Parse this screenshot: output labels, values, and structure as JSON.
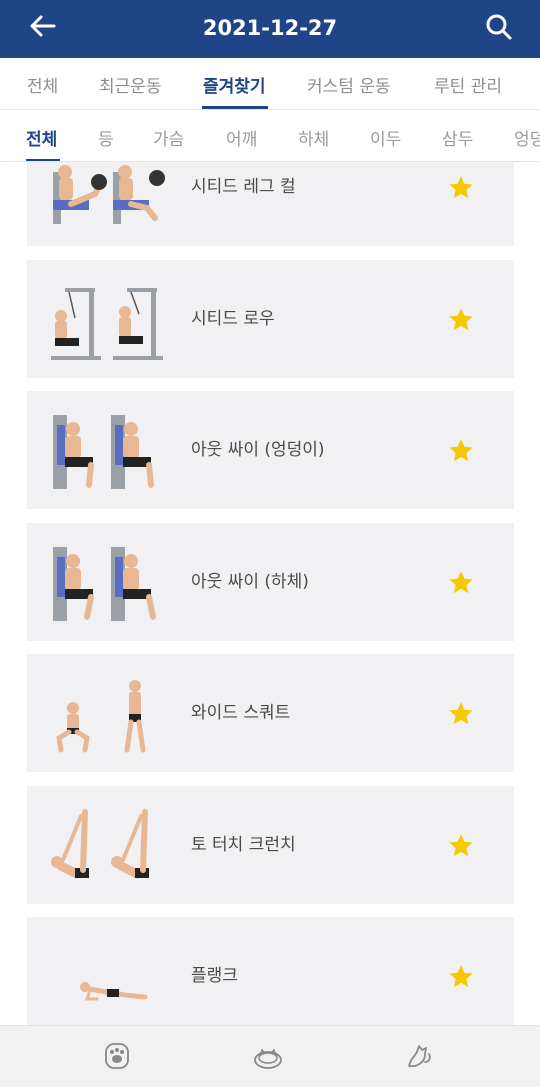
{
  "header": {
    "title": "2021-12-27",
    "back_icon": "back-arrow-icon",
    "search_icon": "search-icon",
    "background": "#1f4588"
  },
  "main_tabs": [
    {
      "label": "전체"
    },
    {
      "label": "최근운동"
    },
    {
      "label": "즐겨찾기",
      "active": true
    },
    {
      "label": "커스텀 운동"
    },
    {
      "label": "루틴 관리"
    }
  ],
  "body_tabs": [
    {
      "label": "전체",
      "active": true
    },
    {
      "label": "등"
    },
    {
      "label": "가슴"
    },
    {
      "label": "어깨"
    },
    {
      "label": "하체"
    },
    {
      "label": "이두"
    },
    {
      "label": "삼두"
    },
    {
      "label": "엉덩"
    }
  ],
  "exercises": [
    {
      "name": "시티드 레그 컬",
      "favorite": true
    },
    {
      "name": "시티드 로우",
      "favorite": true
    },
    {
      "name": "아웃 싸이 (엉덩이)",
      "favorite": true
    },
    {
      "name": "아웃 싸이 (하체)",
      "favorite": true
    },
    {
      "name": "와이드 스쿼트",
      "favorite": true
    },
    {
      "name": "토 터치 크런치",
      "favorite": true
    },
    {
      "name": "플랭크",
      "favorite": true
    }
  ],
  "bottom_nav": [
    {
      "icon": "paw-icon"
    },
    {
      "icon": "sleeping-cat-icon"
    },
    {
      "icon": "stretching-cat-icon"
    }
  ],
  "colors": {
    "accent": "#1f4588",
    "star": "#f5c800",
    "card": "#f1f1f3"
  }
}
